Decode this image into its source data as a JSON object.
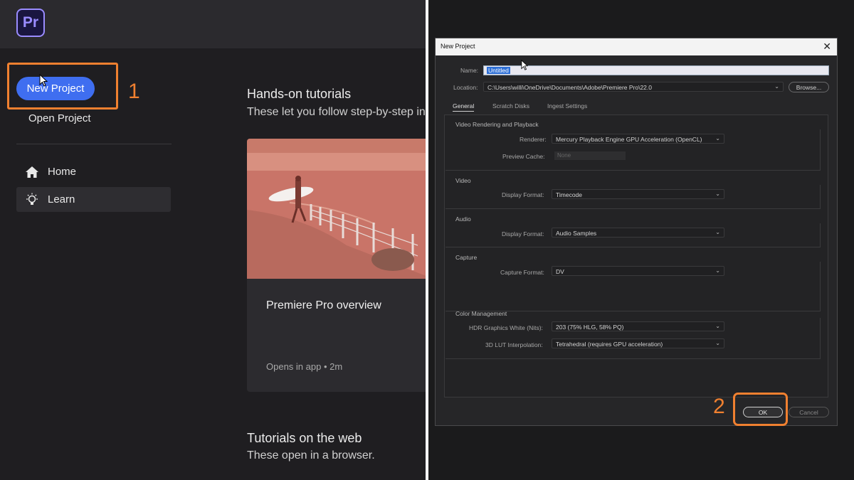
{
  "left": {
    "app_logo": "Pr",
    "new_project_label": "New Project",
    "step_label": "1",
    "open_project_label": "Open Project",
    "nav": [
      {
        "label": "Home",
        "icon": "home-icon"
      },
      {
        "label": "Learn",
        "icon": "lightbulb-icon"
      }
    ],
    "tutorials": {
      "title": "Hands-on tutorials",
      "subtitle": "These let you follow step-by-step inst",
      "card": {
        "title": "Premiere Pro overview",
        "meta": "Opens in app • 2m"
      }
    },
    "web_tutorials": {
      "title": "Tutorials on the web",
      "subtitle": "These open in a browser."
    }
  },
  "dialog": {
    "title": "New Project",
    "close_label": "✕",
    "name_label": "Name:",
    "name_value": "Untitled",
    "location_label": "Location:",
    "location_value": "C:\\Users\\willi\\OneDrive\\Documents\\Adobe\\Premiere Pro\\22.0",
    "browse_label": "Browse...",
    "tabs": [
      "General",
      "Scratch Disks",
      "Ingest Settings"
    ],
    "groups": {
      "video_rendering": {
        "title": "Video Rendering and Playback",
        "renderer_label": "Renderer:",
        "renderer_value": "Mercury Playback Engine GPU Acceleration (OpenCL)",
        "preview_cache_label": "Preview Cache:",
        "preview_cache_value": "None"
      },
      "video": {
        "title": "Video",
        "display_format_label": "Display Format:",
        "display_format_value": "Timecode"
      },
      "audio": {
        "title": "Audio",
        "display_format_label": "Display Format:",
        "display_format_value": "Audio Samples"
      },
      "capture": {
        "title": "Capture",
        "capture_format_label": "Capture Format:",
        "capture_format_value": "DV"
      },
      "color": {
        "title": "Color Management",
        "hdr_label": "HDR Graphics White (Nits):",
        "hdr_value": "203 (75% HLG, 58% PQ)",
        "lut_label": "3D LUT Interpolation:",
        "lut_value": "Tetrahedral (requires GPU acceleration)"
      }
    },
    "ok_label": "OK",
    "cancel_label": "Cancel",
    "step_label": "2"
  },
  "colors": {
    "accent_blue": "#3f6ef0",
    "highlight_orange": "#f08030",
    "premiere_purple": "#9a8cff"
  }
}
